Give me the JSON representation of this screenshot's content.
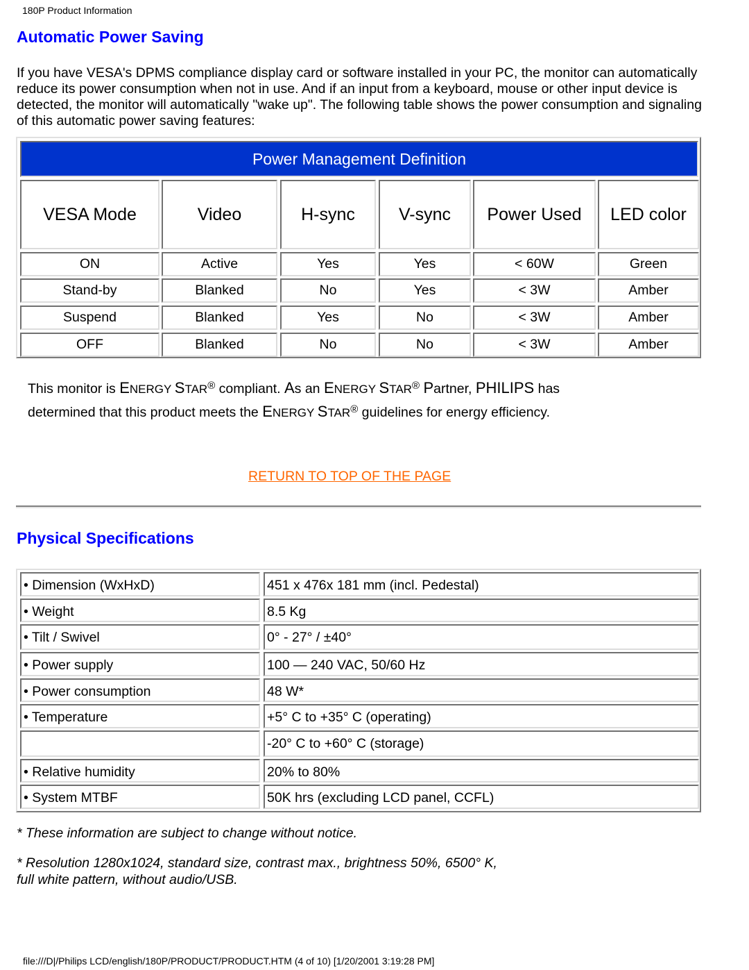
{
  "page_header": "180P Product Information",
  "sections": {
    "automatic_power_saving": {
      "title": "Automatic Power Saving",
      "intro": "If you have VESA's DPMS compliance display card or software installed in your PC, the monitor can automatically reduce its power consumption when not in use. And if an input from a keyboard, mouse or other input device is detected, the monitor will automatically \"wake up\". The following table shows the power consumption and signaling of this automatic power saving features:"
    },
    "physical_specifications": {
      "title": "Physical Specifications"
    }
  },
  "power_table": {
    "title": "Power Management Definition",
    "title_bg": "#0033cc",
    "headers": [
      "VESA Mode",
      "Video",
      "H-sync",
      "V-sync",
      "Power Used",
      "LED color"
    ],
    "rows": [
      [
        "ON",
        "Active",
        "Yes",
        "Yes",
        "< 60W",
        "Green"
      ],
      [
        "Stand-by",
        "Blanked",
        "No",
        "Yes",
        "< 3W",
        "Amber"
      ],
      [
        "Suspend",
        "Blanked",
        "Yes",
        "No",
        "< 3W",
        "Amber"
      ],
      [
        "OFF",
        "Blanked",
        "No",
        "No",
        "< 3W",
        "Amber"
      ]
    ]
  },
  "energy_star": {
    "line1_parts": [
      "This monitor is ",
      "E",
      "NERGY ",
      "S",
      "TAR",
      "®",
      " compliant. ",
      "A",
      "s an ",
      "E",
      "NERGY ",
      "S",
      "TAR",
      "®",
      " ",
      "P",
      "artner, ",
      "PHILIPS",
      " has"
    ],
    "line2_parts": [
      "determined that this product meets the ",
      "E",
      "NERGY ",
      "S",
      "TAR",
      "®",
      " guidelines for energy efficiency."
    ]
  },
  "return_link": {
    "label": "RETURN TO TOP OF THE PAGE",
    "color": "#ff6600"
  },
  "spec_table": {
    "rows": [
      {
        "label": "• Dimension (WxHxD)",
        "value": "451 x 476x 181 mm (incl. Pedestal)"
      },
      {
        "label": "• Weight",
        "value": "8.5 Kg"
      },
      {
        "label": "• Tilt / Swivel",
        "value": "0° - 27° / ±40°"
      },
      {
        "label": "• Power supply",
        "value": "100 — 240 VAC, 50/60 Hz"
      },
      {
        "label": "• Power consumption",
        "value": "48 W*"
      },
      {
        "label": "• Temperature",
        "value": "+5° C to +35° C (operating)"
      },
      {
        "label": "",
        "value": "-20° C to +60° C (storage)"
      },
      {
        "label": "• Relative humidity",
        "value": "20% to 80%"
      },
      {
        "label": "• System MTBF",
        "value": "50K hrs (excluding LCD panel, CCFL)"
      }
    ]
  },
  "notes": {
    "note1": "* These information are subject to change without notice.",
    "note2_line1": "* Resolution 1280x1024, standard size, contrast max., brightness 50%, 6500° K,",
    "note2_line2": "full white pattern, without audio/USB."
  },
  "footer": "file:///D|/Philips LCD/english/180P/PRODUCT/PRODUCT.HTM (4 of 10) [1/20/2001 3:19:28 PM]"
}
